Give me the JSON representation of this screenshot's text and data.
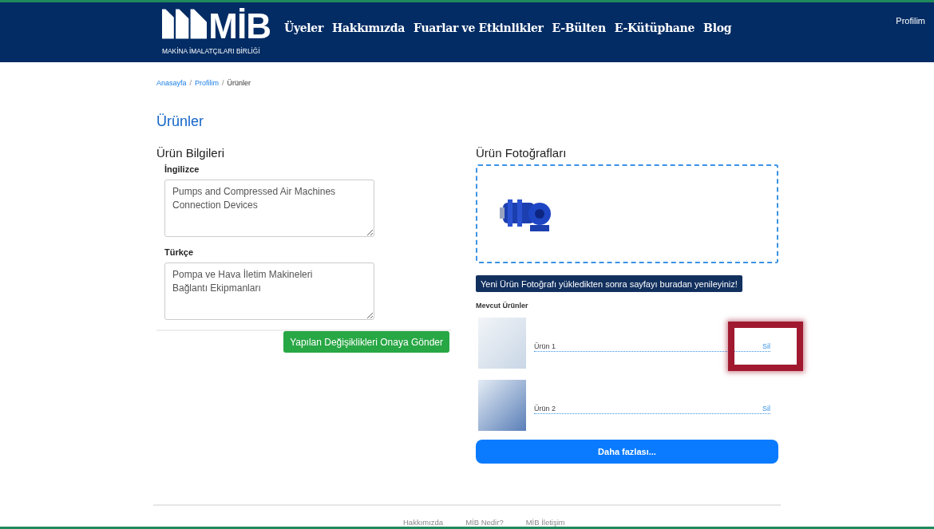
{
  "header": {
    "logo_mark": "MİB",
    "logo_subtitle": "MAKİNA İMALATÇILARI BİRLİĞİ",
    "nav": [
      "Üyeler",
      "Hakkımızda",
      "Fuarlar ve Etkinlikler",
      "E-Bülten",
      "E-Kütüphane",
      "Blog"
    ],
    "profile_link": "Profilim"
  },
  "breadcrumb": [
    {
      "label": "Anasayfa",
      "current": false
    },
    {
      "separator": "/",
      "label": "Profilim",
      "current": false
    },
    {
      "separator": "/",
      "label": "Ürünler",
      "current": true
    }
  ],
  "page_title": "Ürünler",
  "info": {
    "heading": "Ürün Bilgileri",
    "fields": [
      {
        "label": "İngilizce",
        "value": "Pumps and Compressed Air Machines\nConnection Devices"
      },
      {
        "label": "Türkçe",
        "value": "Pompa ve Hava İletim Makineleri\nBağlantı Ekipmanları"
      }
    ],
    "submit_button": "Yapılan Değişiklikleri Onaya Gönder"
  },
  "photos": {
    "heading": "Ürün Fotoğrafları",
    "refresh_button": "Yeni Ürün Fotoğrafı yükledikten sonra sayfayı buradan yenileyiniz!",
    "list_title": "Mevcut Ürünler",
    "products": [
      {
        "name": "Ürün 1",
        "delete_link": "Sil",
        "highlighted": true
      },
      {
        "name": "Ürün 2",
        "delete_link": "Sil",
        "highlighted": false
      }
    ],
    "more_button": "Daha fazlası..."
  },
  "footer_links": [
    "Hakkımızda",
    "MİB Nedir?",
    "MİB İletişim"
  ]
}
